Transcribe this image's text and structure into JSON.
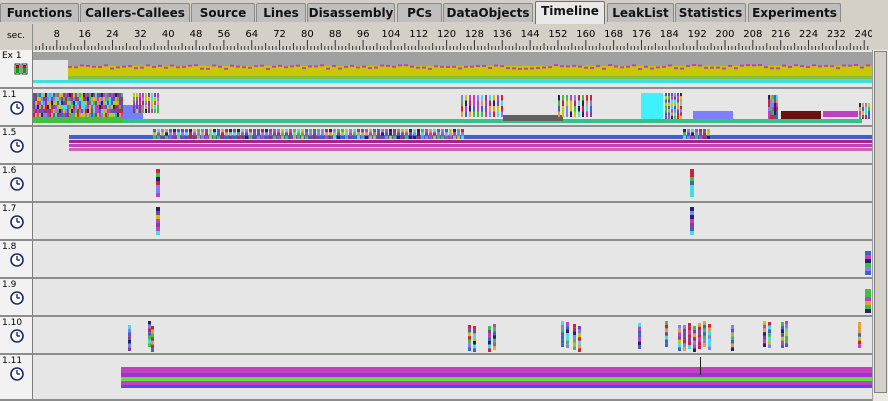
{
  "tabs": [
    {
      "label": "Functions",
      "selected": false
    },
    {
      "label": "Callers-Callees",
      "selected": false
    },
    {
      "label": "Source",
      "selected": false
    },
    {
      "label": "Lines",
      "selected": false
    },
    {
      "label": "Disassembly",
      "selected": false
    },
    {
      "label": "PCs",
      "selected": false
    },
    {
      "label": "DataObjects",
      "selected": false
    },
    {
      "label": "Timeline",
      "selected": true
    },
    {
      "label": "LeakList",
      "selected": false
    },
    {
      "label": "Statistics",
      "selected": false
    },
    {
      "label": "Experiments",
      "selected": false
    }
  ],
  "ruler": {
    "unit_label": "sec.",
    "ticks": [
      "8",
      "16",
      "24",
      "32",
      "40",
      "48",
      "56",
      "64",
      "72",
      "80",
      "88",
      "96",
      "104",
      "112",
      "120",
      "128",
      "136",
      "144",
      "152",
      "160",
      "168",
      "176",
      "184",
      "192",
      "200",
      "208",
      "216",
      "224",
      "232",
      "240"
    ]
  },
  "rows": [
    {
      "id": "Ex 1",
      "icon": "stacked-bars-icon"
    },
    {
      "id": "1.1",
      "icon": "clock-icon"
    },
    {
      "id": "1.5",
      "icon": "clock-icon"
    },
    {
      "id": "1.6",
      "icon": "clock-icon"
    },
    {
      "id": "1.7",
      "icon": "clock-icon"
    },
    {
      "id": "1.8",
      "icon": "clock-icon"
    },
    {
      "id": "1.9",
      "icon": "clock-icon"
    },
    {
      "id": "1.10",
      "icon": "clock-icon"
    },
    {
      "id": "1.11",
      "icon": "clock-icon"
    }
  ],
  "colors": {
    "tab_bg": "#bfbfbf",
    "tab_selected_bg": "#e8e8e8",
    "row_bg": "#e6e6e6",
    "olive": "#c8c800",
    "magenta": "#c040c0",
    "green": "#40c040",
    "blue": "#4060d0",
    "cyan": "#40e0e0",
    "violet": "#8040a0",
    "orange": "#e0a040",
    "red": "#d02040"
  }
}
